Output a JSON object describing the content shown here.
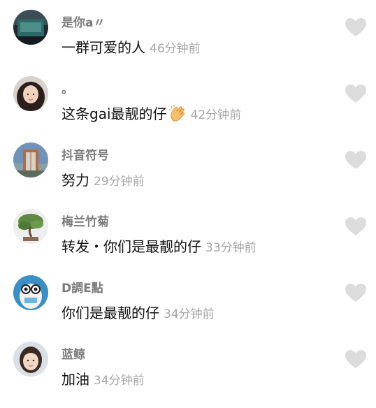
{
  "comments": [
    {
      "username": "是你a〃",
      "text": "一群可爱的人",
      "time": "46分钟前",
      "avatar": "dark-scenery-avatar"
    },
    {
      "username": "。",
      "text": "这条gai最靓的仔",
      "time": "42分钟前",
      "avatar": "girl-portrait-avatar",
      "emoji": "clapping-hands-icon"
    },
    {
      "username": "抖音符号",
      "text": "努力",
      "time": "29分钟前",
      "avatar": "building-avatar"
    },
    {
      "username": "梅兰竹菊",
      "text": "转发・你们是最靓的仔",
      "time": "33分钟前",
      "avatar": "bonsai-tree-avatar"
    },
    {
      "username": "D調E點",
      "text": "你们是最靓的仔",
      "time": "34分钟前",
      "avatar": "penguin-cartoon-avatar"
    },
    {
      "username": "蓝鲸",
      "text": "加油",
      "time": "34分钟前",
      "avatar": "child-portrait-avatar"
    }
  ],
  "colors": {
    "username": "#7b7b7b",
    "text": "#111111",
    "time": "#a5a5a5",
    "like_icon": "#dcdcdc"
  }
}
